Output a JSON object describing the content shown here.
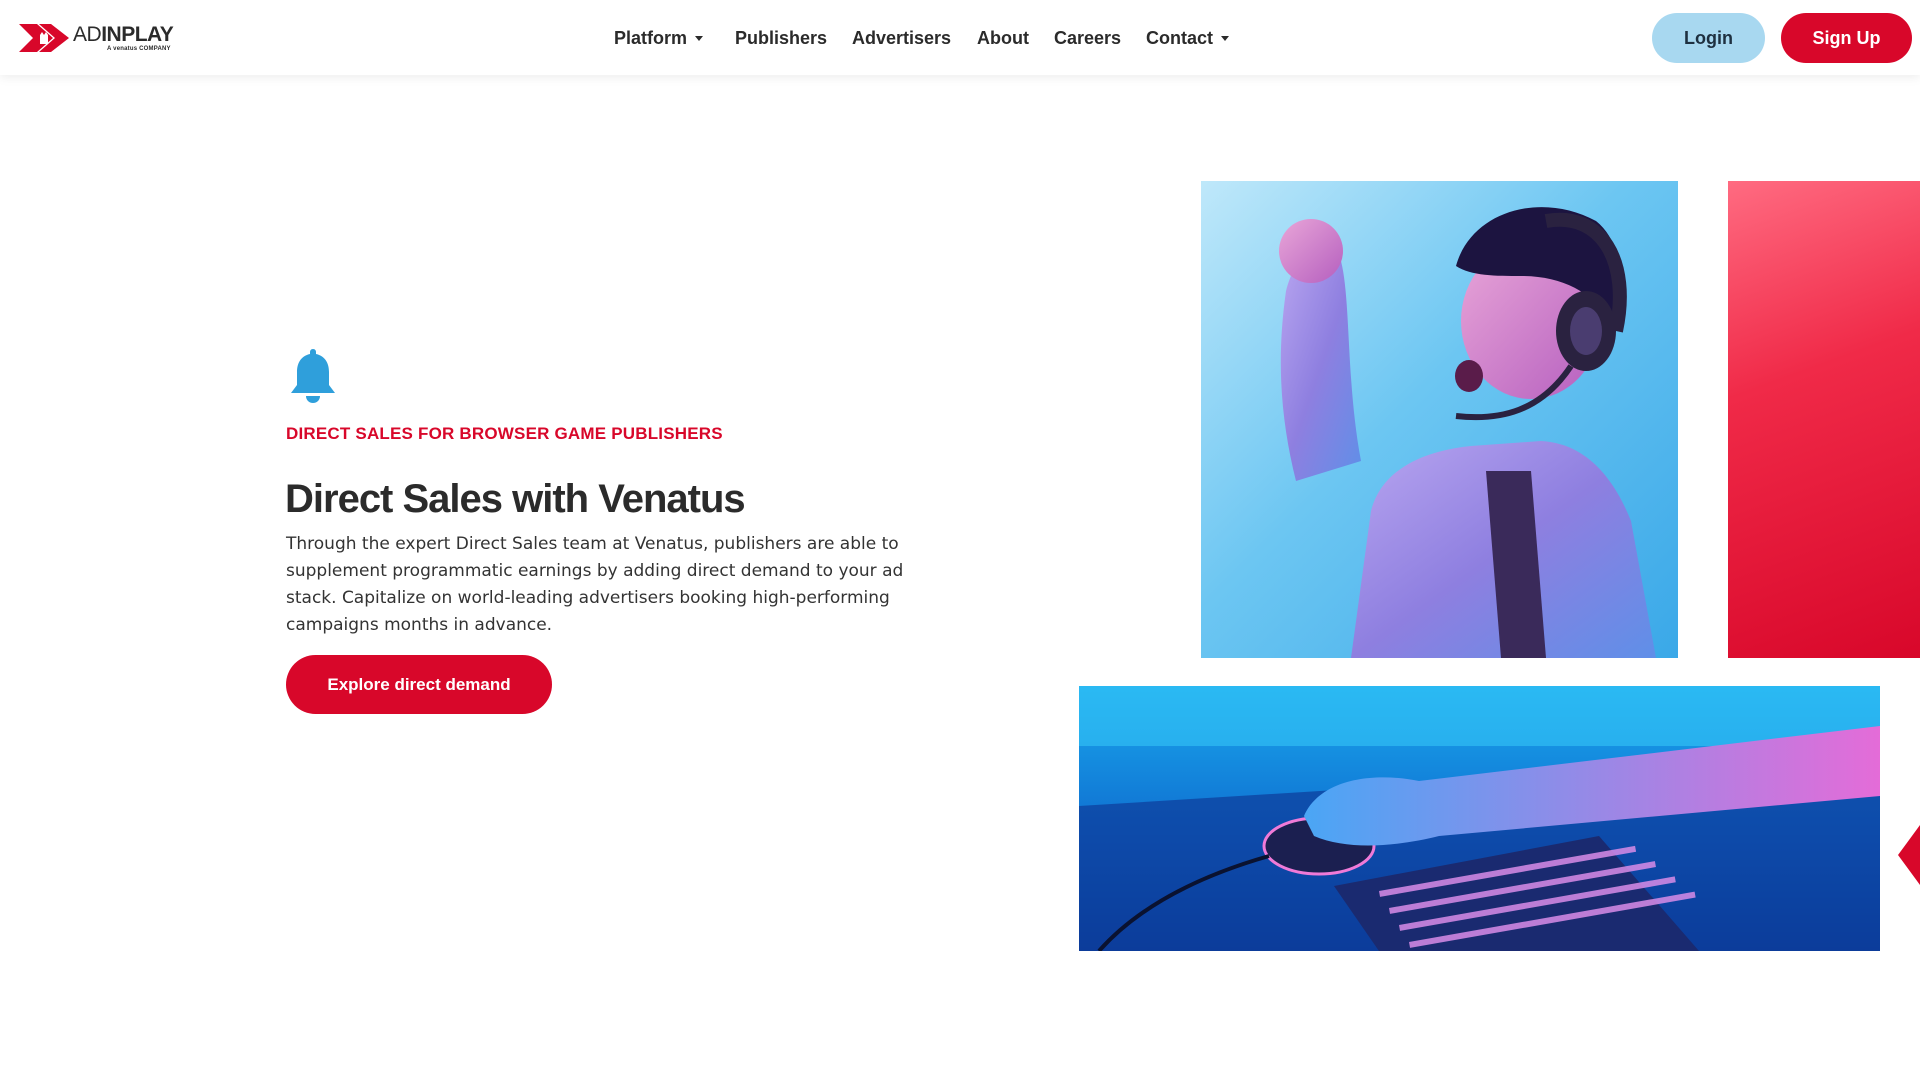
{
  "brand": {
    "logo_ad": "AD",
    "logo_inplay": "INPLAY",
    "logo_sub": "A venatus COMPANY",
    "accent_red": "#d8072a",
    "accent_blue": "#a8d8f0",
    "icon_blue": "#2f9fdb"
  },
  "nav": {
    "items": [
      {
        "label": "Platform",
        "has_dropdown": true
      },
      {
        "label": "Publishers",
        "has_dropdown": false
      },
      {
        "label": "Advertisers",
        "has_dropdown": false
      },
      {
        "label": "About",
        "has_dropdown": false
      },
      {
        "label": "Careers",
        "has_dropdown": false
      },
      {
        "label": "Contact",
        "has_dropdown": true
      }
    ],
    "login_label": "Login",
    "signup_label": "Sign Up"
  },
  "hero": {
    "icon": "bell-icon",
    "eyebrow": "DIRECT SALES FOR BROWSER GAME PUBLISHERS",
    "title": "Direct Sales with Venatus",
    "body": "Through the expert Direct Sales team at Venatus, publishers are able to supplement programmatic earnings by adding direct demand to your ad stack. Capitalize on world-leading advertisers booking high-performing campaigns months in advance.",
    "cta_label": "Explore direct demand"
  },
  "imagery": {
    "photo_1": "gamer-with-headset-photo",
    "photo_2": "red-panel",
    "photo_3": "keyboard-and-mouse-photo"
  }
}
